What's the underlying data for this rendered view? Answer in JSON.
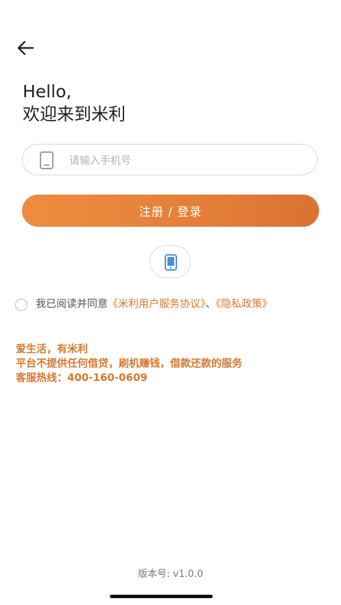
{
  "header": {
    "back_icon": "arrow-left-icon"
  },
  "greeting": {
    "line1": "Hello,",
    "line2": "欢迎来到米利"
  },
  "phone_input": {
    "icon": "phone-icon",
    "placeholder": "请输入手机号",
    "value": ""
  },
  "submit": {
    "label": "注册 / 登录"
  },
  "alt_login": {
    "icon": "mobile-phone-icon"
  },
  "agreement": {
    "checked": false,
    "prefix": "我已阅读并同意",
    "link1": "《米利用户服务协议》",
    "separator": "、",
    "link2": "《隐私政策》"
  },
  "info": {
    "line1": "爱生活，有米利",
    "line2": "平台不提供任何借贷，刷机赚钱，借款还款的服务",
    "line3": "客服热线：400-160-0609"
  },
  "footer": {
    "version": "版本号: v1.0.0"
  },
  "colors": {
    "accent": "#e5803a",
    "link": "#d9772f",
    "alt_icon": "#4a90e2"
  }
}
